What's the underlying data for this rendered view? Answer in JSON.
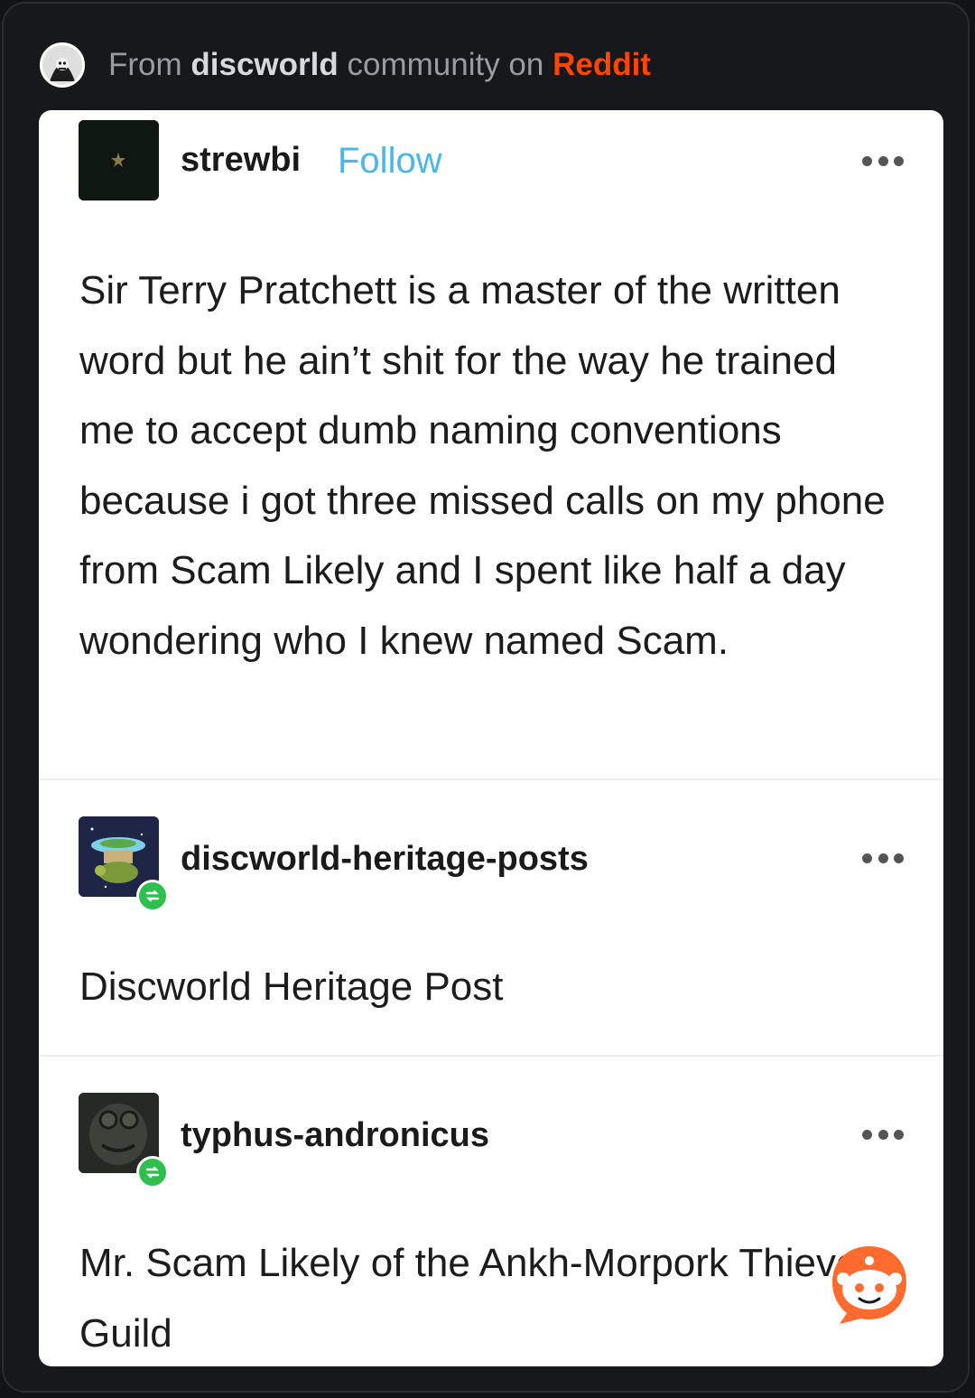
{
  "header": {
    "prefix": "From ",
    "community": "discworld",
    "middle": " community on ",
    "site": "Reddit",
    "brand_color": "#ff4500"
  },
  "posts": [
    {
      "username": "strewbi",
      "follow_label": "Follow",
      "more_icon": "more-dots-icon",
      "text": "Sir Terry Pratchett is a master of the written word but he ain’t shit for the way he trained me to accept dumb naming conventions because i got three missed calls on my phone from Scam Likely and I spent like half a day wondering who I knew named Scam."
    },
    {
      "username": "discworld-heritage-posts",
      "reblog_icon": "reblog-icon",
      "more_icon": "more-dots-icon",
      "text": "Discworld Heritage Post"
    },
    {
      "username": "typhus-andronicus",
      "reblog_icon": "reblog-icon",
      "more_icon": "more-dots-icon",
      "text": "Mr. Scam Likely of the Ankh-Morpork Thieves’ Guild"
    }
  ],
  "colors": {
    "follow": "#4bb6e8",
    "reblog_badge": "#2fbf4f"
  }
}
